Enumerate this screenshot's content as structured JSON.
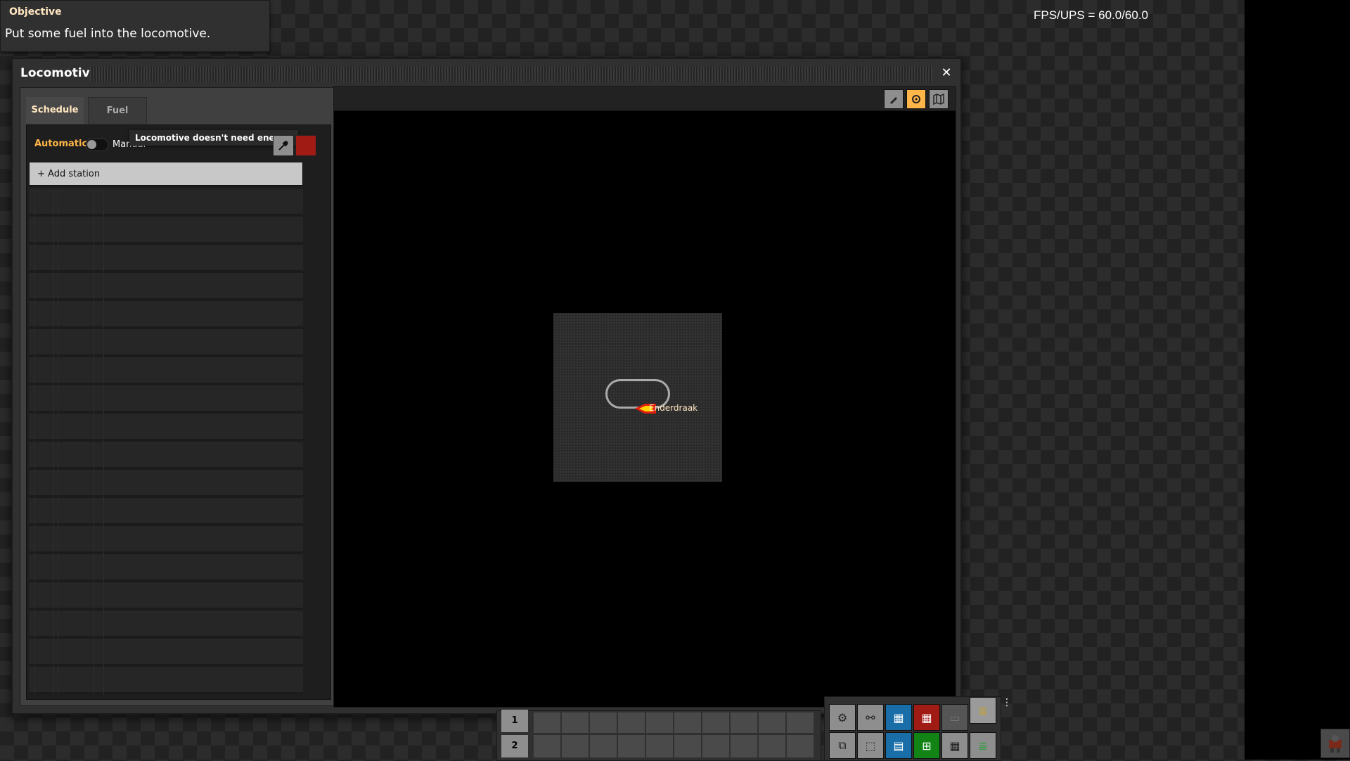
{
  "objective": {
    "title": "Objective",
    "text": "Put some fuel into the locomotive."
  },
  "fps_text": "FPS/UPS = 60.0/60.0",
  "window": {
    "title": "Locomotive",
    "close": "✕"
  },
  "tabs": [
    {
      "label": "Schedule",
      "active": true
    },
    {
      "label": "Fuel",
      "active": false
    }
  ],
  "schedule": {
    "mode_automatic": "Automatic",
    "mode_manual": "Manual",
    "mode_is_automatic": false,
    "tooltip": "Locomotive doesn't need energy.",
    "add_station": "+ Add station"
  },
  "map": {
    "player_label": "Enderdraak",
    "toolbar_active": "center-on-train"
  },
  "hotbar": {
    "rows": [
      "1",
      "2"
    ]
  },
  "colors": {
    "accent": "#ffb648",
    "panel": "#313031",
    "red": "#a11b15",
    "blue": "#1a6ea8",
    "green": "#128416"
  }
}
